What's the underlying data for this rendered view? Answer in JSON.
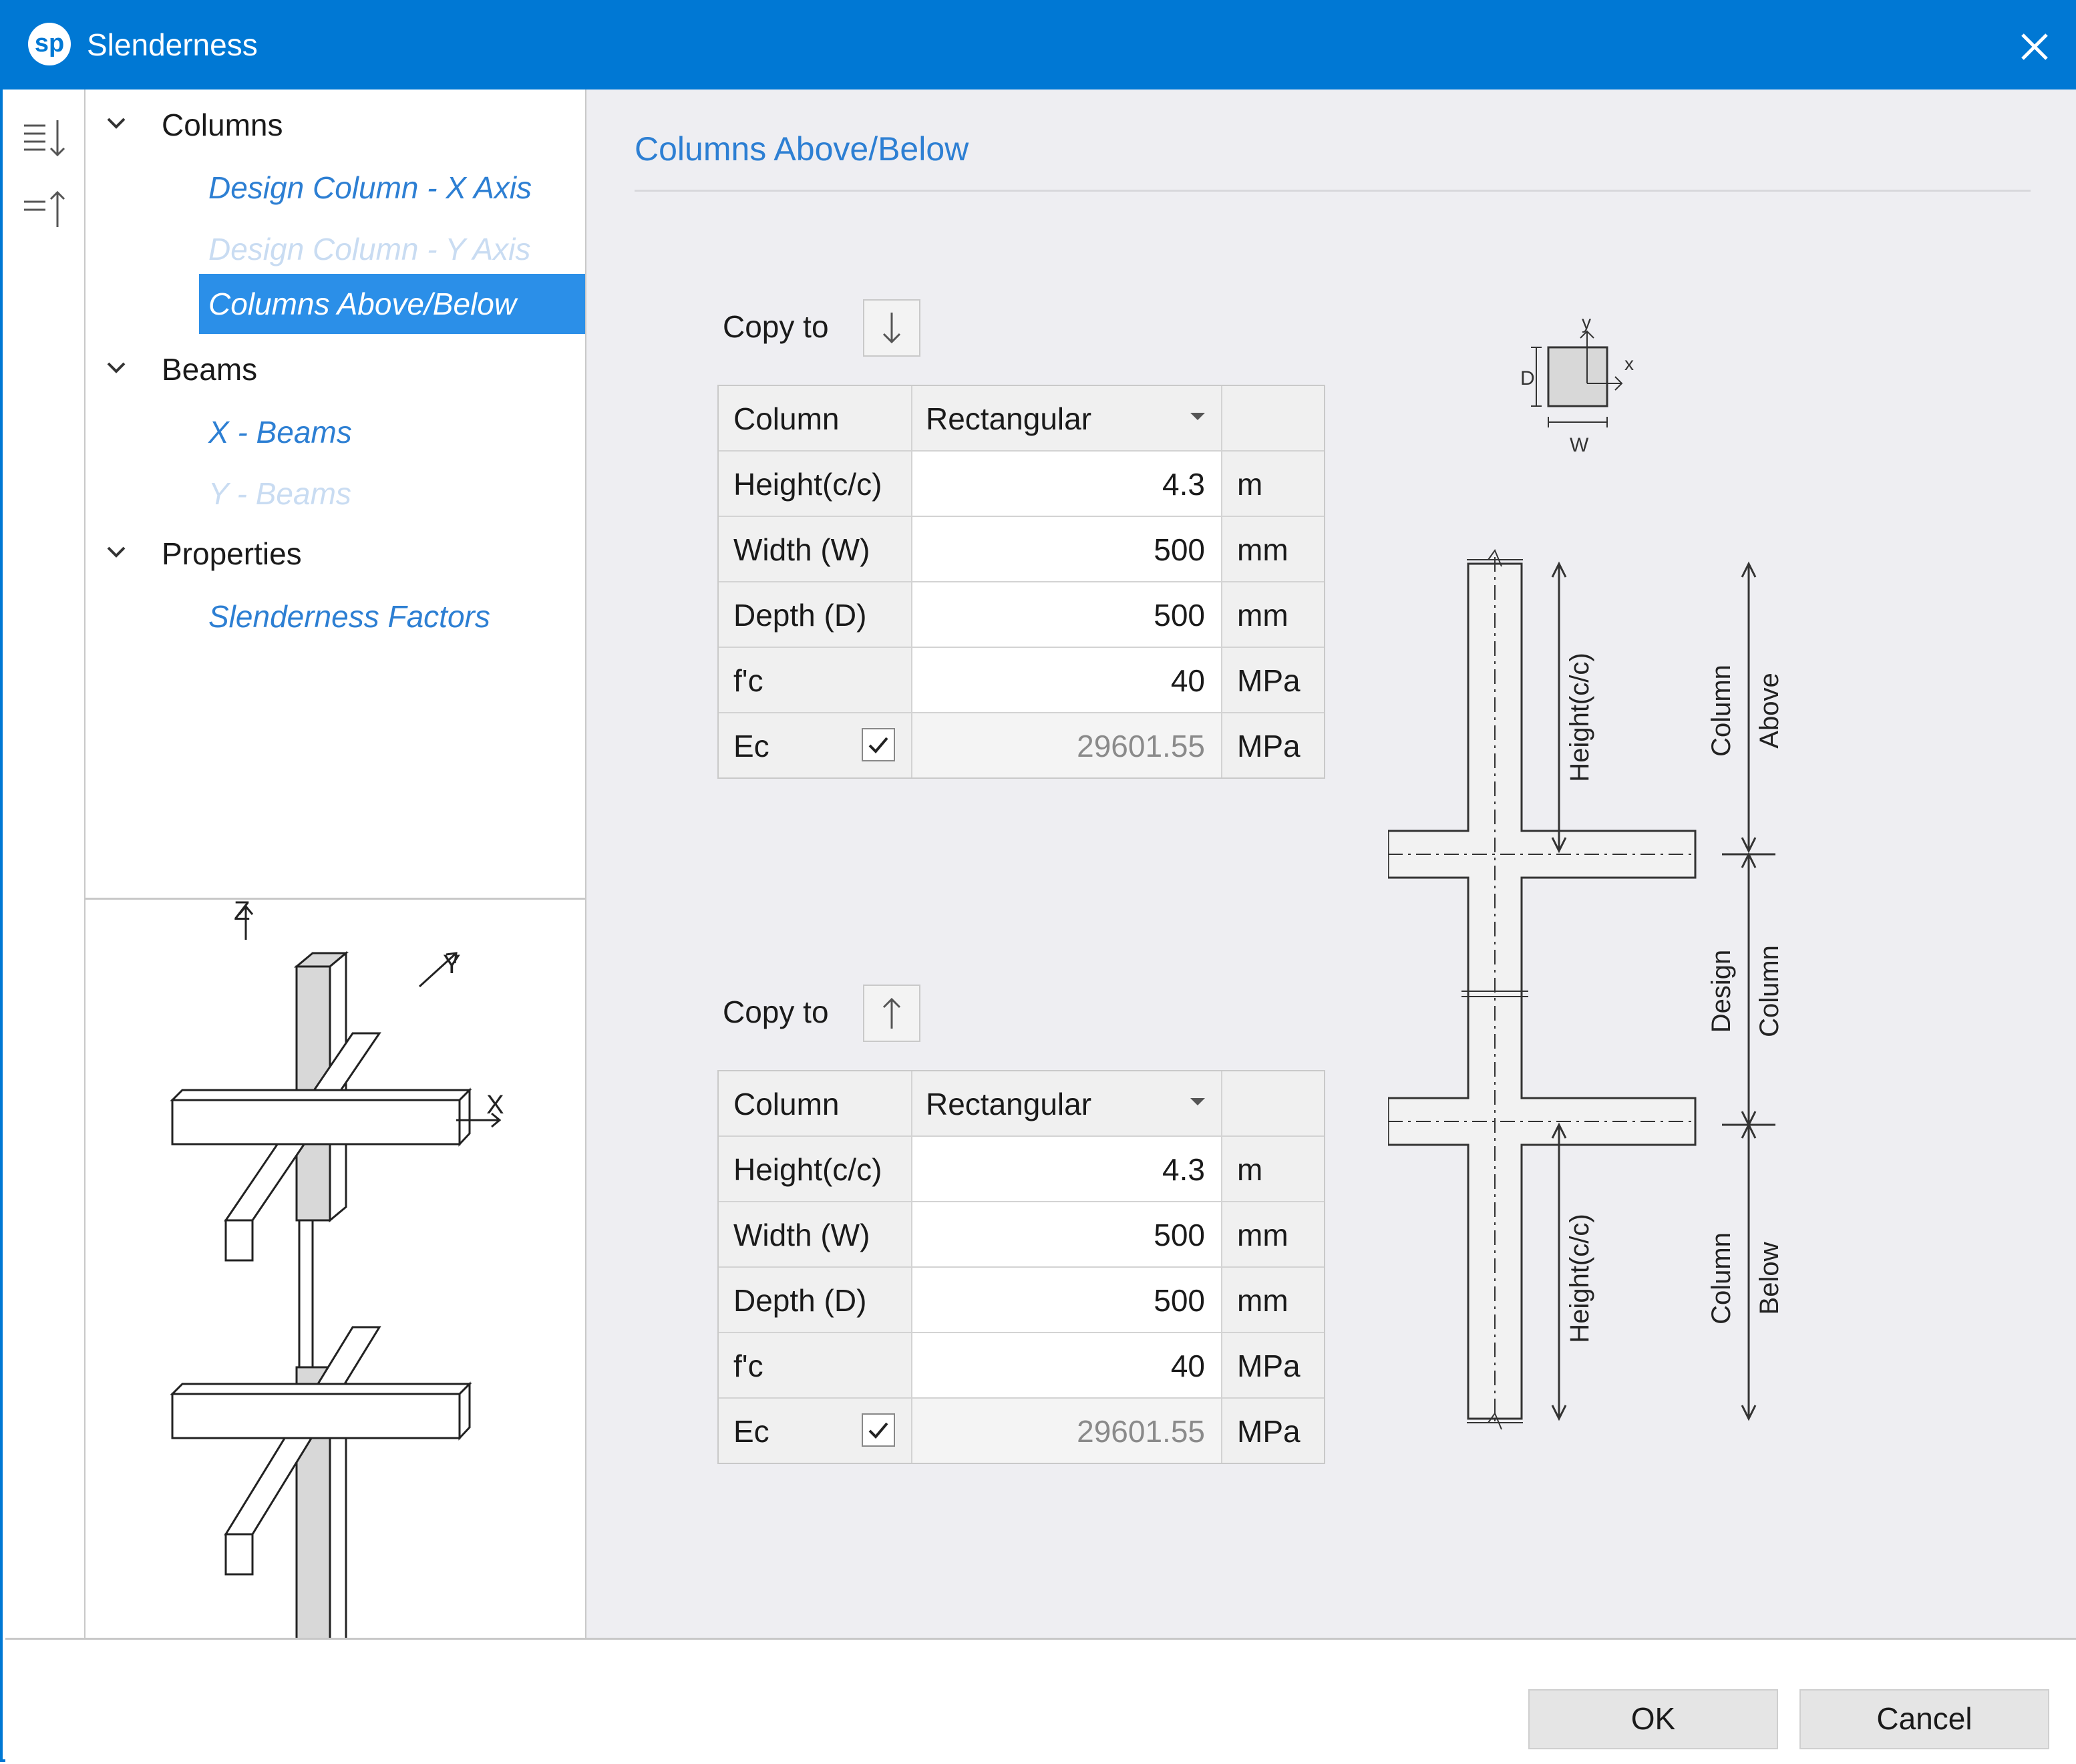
{
  "window": {
    "title": "Slenderness",
    "logo": "sp"
  },
  "toolbar": {
    "expand_icon": "sort-down-icon",
    "collapse_icon": "sort-up-icon"
  },
  "tree": {
    "groups": [
      {
        "label": "Columns",
        "items": [
          {
            "label": "Design Column - X Axis",
            "state": "enabled"
          },
          {
            "label": "Design Column - Y Axis",
            "state": "disabled"
          },
          {
            "label": "Columns Above/Below",
            "state": "selected"
          }
        ]
      },
      {
        "label": "Beams",
        "items": [
          {
            "label": "X - Beams",
            "state": "enabled"
          },
          {
            "label": "Y - Beams",
            "state": "disabled"
          }
        ]
      },
      {
        "label": "Properties",
        "items": [
          {
            "label": "Slenderness Factors",
            "state": "enabled"
          }
        ]
      }
    ]
  },
  "thumbnail": {
    "axis_z": "Z",
    "axis_y": "Y",
    "axis_x": "X"
  },
  "section": {
    "title": "Columns Above/Below"
  },
  "above": {
    "copy_label": "Copy to",
    "copy_icon": "arrow-down-icon",
    "header": {
      "label": "Column",
      "shape": "Rectangular"
    },
    "rows": [
      {
        "label": "Height(c/c)",
        "value": "4.3",
        "unit": "m"
      },
      {
        "label": "Width (W)",
        "value": "500",
        "unit": "mm"
      },
      {
        "label": "Depth (D)",
        "value": "500",
        "unit": "mm"
      },
      {
        "label": "f'c",
        "value": "40",
        "unit": "MPa"
      }
    ],
    "ec": {
      "label": "Ec",
      "checked": true,
      "value": "29601.55",
      "unit": "MPa"
    }
  },
  "below": {
    "copy_label": "Copy to",
    "copy_icon": "arrow-up-icon",
    "header": {
      "label": "Column",
      "shape": "Rectangular"
    },
    "rows": [
      {
        "label": "Height(c/c)",
        "value": "4.3",
        "unit": "m"
      },
      {
        "label": "Width (W)",
        "value": "500",
        "unit": "mm"
      },
      {
        "label": "Depth (D)",
        "value": "500",
        "unit": "mm"
      },
      {
        "label": "f'c",
        "value": "40",
        "unit": "MPa"
      }
    ],
    "ec": {
      "label": "Ec",
      "checked": true,
      "value": "29601.55",
      "unit": "MPa"
    }
  },
  "diagram": {
    "section_d": "D",
    "section_w": "W",
    "section_x": "x",
    "section_y": "y",
    "height_label": "Height(c/c)",
    "above_line1": "Column",
    "above_line2": "Above",
    "design_line1": "Design",
    "design_line2": "Column",
    "below_line1": "Column",
    "below_line2": "Below"
  },
  "footer": {
    "ok": "OK",
    "cancel": "Cancel"
  },
  "colors": {
    "titlebar": "#0078d4",
    "accent_text": "#2d7fd3",
    "selection": "#2b8fe8",
    "panel": "#eeeef2"
  }
}
